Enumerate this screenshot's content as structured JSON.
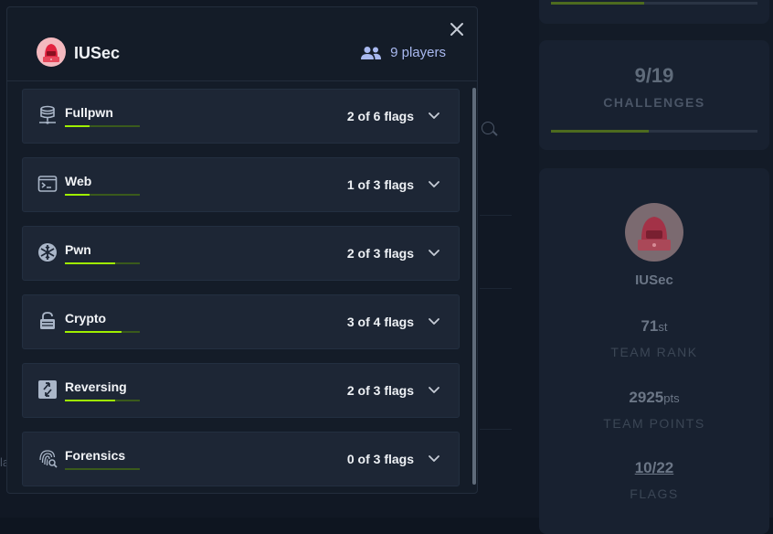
{
  "modal": {
    "team_name": "IUSec",
    "players_label": "9 players",
    "categories": [
      {
        "name": "Fullpwn",
        "flags": "2 of 6 flags",
        "progress": 0.333,
        "icon": "server-icon"
      },
      {
        "name": "Web",
        "flags": "1 of 3 flags",
        "progress": 0.333,
        "icon": "terminal-window-icon"
      },
      {
        "name": "Pwn",
        "flags": "2 of 3 flags",
        "progress": 0.667,
        "icon": "snowflake-icon"
      },
      {
        "name": "Crypto",
        "flags": "3 of 4 flags",
        "progress": 0.75,
        "icon": "unlocked-padlock-icon"
      },
      {
        "name": "Reversing",
        "flags": "2 of 3 flags",
        "progress": 0.667,
        "icon": "reverse-arrows-icon"
      },
      {
        "name": "Forensics",
        "flags": "0 of 3 flags",
        "progress": 0.0,
        "icon": "fingerprint-search-icon"
      }
    ]
  },
  "background": {
    "challenges_count": "9/19",
    "challenges_label": "CHALLENGES",
    "challenges_progress": 0.474,
    "top_progress": 0.45,
    "team_name": "IUSec",
    "rank_value": "71",
    "rank_suffix": "st",
    "rank_label": "TEAM RANK",
    "points_value": "2925",
    "points_suffix": "pts",
    "points_label": "TEAM POINTS",
    "flags_value": "10/22",
    "flags_label": "FLAGS",
    "edge_text": "la"
  },
  "colors": {
    "accent_green": "#9fef00",
    "players_blue": "#a9b9f0",
    "modal_bg": "#141c28",
    "card_bg": "#1d2635"
  }
}
